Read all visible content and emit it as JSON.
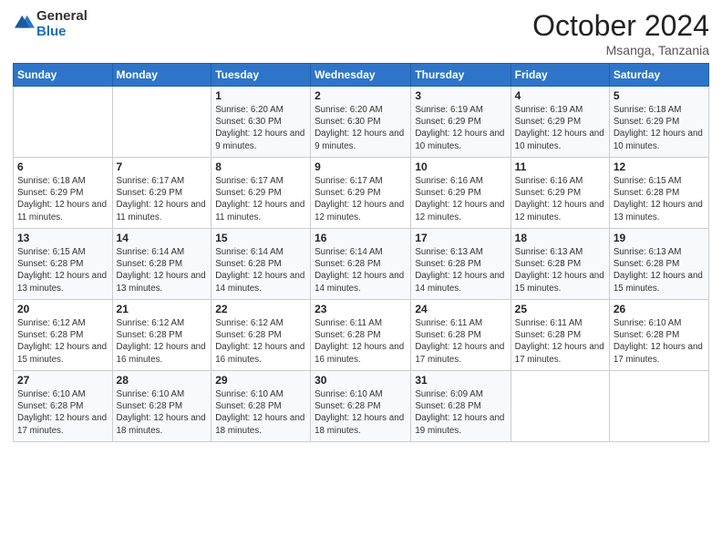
{
  "header": {
    "logo_general": "General",
    "logo_blue": "Blue",
    "month_title": "October 2024",
    "location": "Msanga, Tanzania"
  },
  "days_of_week": [
    "Sunday",
    "Monday",
    "Tuesday",
    "Wednesday",
    "Thursday",
    "Friday",
    "Saturday"
  ],
  "weeks": [
    [
      null,
      null,
      {
        "day": 1,
        "sunrise": "6:20 AM",
        "sunset": "6:30 PM",
        "daylight": "12 hours and 9 minutes."
      },
      {
        "day": 2,
        "sunrise": "6:20 AM",
        "sunset": "6:30 PM",
        "daylight": "12 hours and 9 minutes."
      },
      {
        "day": 3,
        "sunrise": "6:19 AM",
        "sunset": "6:29 PM",
        "daylight": "12 hours and 10 minutes."
      },
      {
        "day": 4,
        "sunrise": "6:19 AM",
        "sunset": "6:29 PM",
        "daylight": "12 hours and 10 minutes."
      },
      {
        "day": 5,
        "sunrise": "6:18 AM",
        "sunset": "6:29 PM",
        "daylight": "12 hours and 10 minutes."
      }
    ],
    [
      {
        "day": 6,
        "sunrise": "6:18 AM",
        "sunset": "6:29 PM",
        "daylight": "12 hours and 11 minutes."
      },
      {
        "day": 7,
        "sunrise": "6:17 AM",
        "sunset": "6:29 PM",
        "daylight": "12 hours and 11 minutes."
      },
      {
        "day": 8,
        "sunrise": "6:17 AM",
        "sunset": "6:29 PM",
        "daylight": "12 hours and 11 minutes."
      },
      {
        "day": 9,
        "sunrise": "6:17 AM",
        "sunset": "6:29 PM",
        "daylight": "12 hours and 12 minutes."
      },
      {
        "day": 10,
        "sunrise": "6:16 AM",
        "sunset": "6:29 PM",
        "daylight": "12 hours and 12 minutes."
      },
      {
        "day": 11,
        "sunrise": "6:16 AM",
        "sunset": "6:29 PM",
        "daylight": "12 hours and 12 minutes."
      },
      {
        "day": 12,
        "sunrise": "6:15 AM",
        "sunset": "6:28 PM",
        "daylight": "12 hours and 13 minutes."
      }
    ],
    [
      {
        "day": 13,
        "sunrise": "6:15 AM",
        "sunset": "6:28 PM",
        "daylight": "12 hours and 13 minutes."
      },
      {
        "day": 14,
        "sunrise": "6:14 AM",
        "sunset": "6:28 PM",
        "daylight": "12 hours and 13 minutes."
      },
      {
        "day": 15,
        "sunrise": "6:14 AM",
        "sunset": "6:28 PM",
        "daylight": "12 hours and 14 minutes."
      },
      {
        "day": 16,
        "sunrise": "6:14 AM",
        "sunset": "6:28 PM",
        "daylight": "12 hours and 14 minutes."
      },
      {
        "day": 17,
        "sunrise": "6:13 AM",
        "sunset": "6:28 PM",
        "daylight": "12 hours and 14 minutes."
      },
      {
        "day": 18,
        "sunrise": "6:13 AM",
        "sunset": "6:28 PM",
        "daylight": "12 hours and 15 minutes."
      },
      {
        "day": 19,
        "sunrise": "6:13 AM",
        "sunset": "6:28 PM",
        "daylight": "12 hours and 15 minutes."
      }
    ],
    [
      {
        "day": 20,
        "sunrise": "6:12 AM",
        "sunset": "6:28 PM",
        "daylight": "12 hours and 15 minutes."
      },
      {
        "day": 21,
        "sunrise": "6:12 AM",
        "sunset": "6:28 PM",
        "daylight": "12 hours and 16 minutes."
      },
      {
        "day": 22,
        "sunrise": "6:12 AM",
        "sunset": "6:28 PM",
        "daylight": "12 hours and 16 minutes."
      },
      {
        "day": 23,
        "sunrise": "6:11 AM",
        "sunset": "6:28 PM",
        "daylight": "12 hours and 16 minutes."
      },
      {
        "day": 24,
        "sunrise": "6:11 AM",
        "sunset": "6:28 PM",
        "daylight": "12 hours and 17 minutes."
      },
      {
        "day": 25,
        "sunrise": "6:11 AM",
        "sunset": "6:28 PM",
        "daylight": "12 hours and 17 minutes."
      },
      {
        "day": 26,
        "sunrise": "6:10 AM",
        "sunset": "6:28 PM",
        "daylight": "12 hours and 17 minutes."
      }
    ],
    [
      {
        "day": 27,
        "sunrise": "6:10 AM",
        "sunset": "6:28 PM",
        "daylight": "12 hours and 17 minutes."
      },
      {
        "day": 28,
        "sunrise": "6:10 AM",
        "sunset": "6:28 PM",
        "daylight": "12 hours and 18 minutes."
      },
      {
        "day": 29,
        "sunrise": "6:10 AM",
        "sunset": "6:28 PM",
        "daylight": "12 hours and 18 minutes."
      },
      {
        "day": 30,
        "sunrise": "6:10 AM",
        "sunset": "6:28 PM",
        "daylight": "12 hours and 18 minutes."
      },
      {
        "day": 31,
        "sunrise": "6:09 AM",
        "sunset": "6:28 PM",
        "daylight": "12 hours and 19 minutes."
      },
      null,
      null
    ]
  ]
}
